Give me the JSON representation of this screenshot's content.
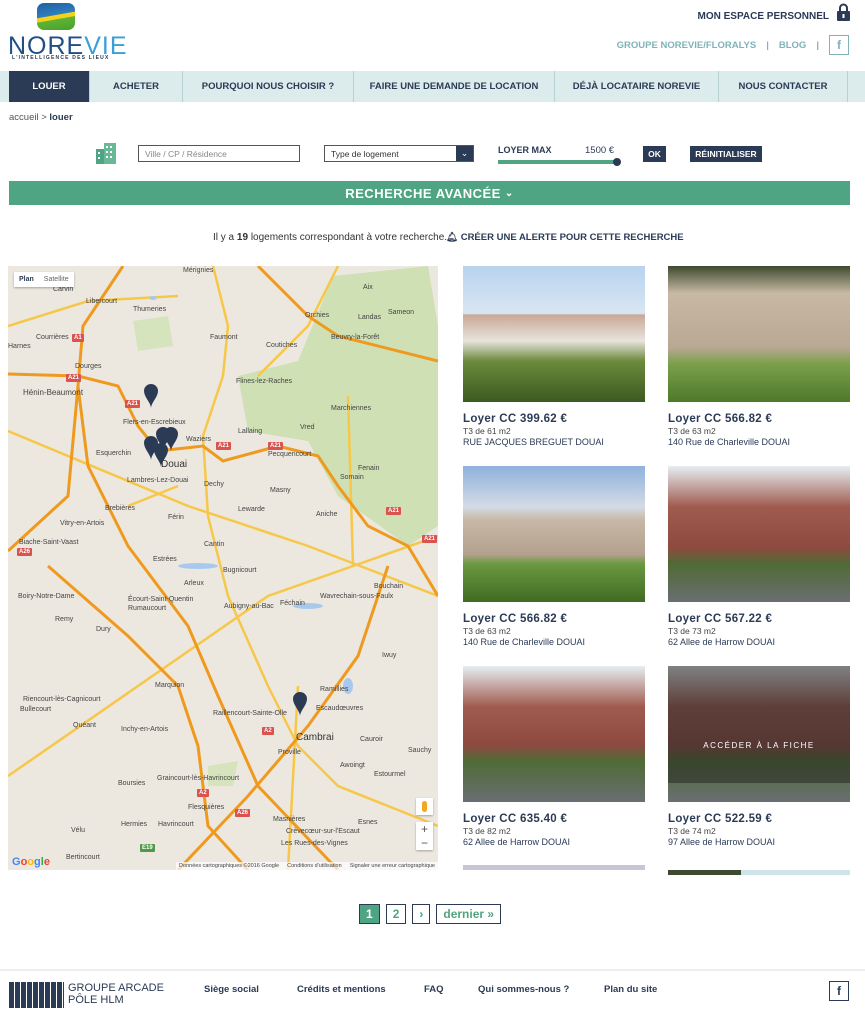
{
  "header": {
    "logo_text": "NOREVIE",
    "logo_tagline": "L'INTELLIGENCE DES LIEUX",
    "espace": "MON ESPACE PERSONNEL",
    "links": [
      "GROUPE NOREVIE/FLORALYS",
      "BLOG"
    ],
    "facebook": "f"
  },
  "nav": [
    "LOUER",
    "ACHETER",
    "POURQUOI NOUS CHOISIR ?",
    "FAIRE UNE DEMANDE DE LOCATION",
    "DÉJÀ LOCATAIRE NOREVIE",
    "NOUS CONTACTER"
  ],
  "breadcrumb": {
    "home": "accueil",
    "sep": ">",
    "current": "louer"
  },
  "search": {
    "placeholder": "Ville / CP / Résidence",
    "type_select": "Type de logement",
    "loyer_label": "LOYER MAX",
    "loyer_value": "1500 €",
    "loyer_fraction": 1.0,
    "ok": "OK",
    "reset": "RÉINITIALISER",
    "advanced": "RECHERCHE AVANCÉE"
  },
  "results": {
    "prefix": "Il y a",
    "count": "19",
    "suffix": "logements correspondant à votre recherche.",
    "alert": "CRÉER UNE ALERTE POUR CETTE RECHERCHE"
  },
  "map": {
    "plan": "Plan",
    "satellite": "Satellite",
    "google": "Google",
    "attribution": [
      "Données cartographiques ©2016 Google",
      "Conditions d'utilisation",
      "Signaler une erreur cartographique"
    ],
    "towns": [
      "Mérignies",
      "Carvin",
      "Libercourt",
      "Thumeries",
      "Courrières",
      "Harnes",
      "Dourges",
      "Hénin-Beaumont",
      "Flers-en-Escrebieux",
      "Waziers",
      "Esquerchin",
      "Douai",
      "Lambres-Lez-Douai",
      "Dechy",
      "Faumont",
      "Coutiches",
      "Flines-lez-Raches",
      "Orchies",
      "Landas",
      "Sameon",
      "Aix",
      "Beuvry-la-Forêt",
      "Marchiennes",
      "Vred",
      "Lallaing",
      "Pecquencourt",
      "Fenain",
      "Somain",
      "Masny",
      "Lewarde",
      "Aniche",
      "Férin",
      "Brebières",
      "Vitry-en-Artois",
      "Biache-Saint-Vaast",
      "Cantin",
      "Estrées",
      "Bugnicourt",
      "Arleux",
      "Aubigny-au-Bac",
      "Féchain",
      "Wavrechain-sous-Faulx",
      "Bouchain",
      "Boiry-Notre-Dame",
      "Remy",
      "Dury",
      "Écourt-Saint-Quentin",
      "Rumaucourt",
      "Iwuy",
      "Marquion",
      "Riencourt-lès-Cagnicourt",
      "Bullecourt",
      "Quéant",
      "Inchy-en-Artois",
      "Raillencourt-Sainte-Olle",
      "Ramillies",
      "Escaudœuvres",
      "Cambrai",
      "Cauroir",
      "Proville",
      "Awoingt",
      "Estourmel",
      "Boursies",
      "Graincourt-lès-Havrincourt",
      "Flesquières",
      "Hermies",
      "Havrincourt",
      "Vélu",
      "Bertincourt",
      "Masnières",
      "Crèvecœur-sur-l'Escaut",
      "Les Rues-des-Vignes",
      "Esnes",
      "Sauchy"
    ],
    "roads": [
      "A1",
      "A21",
      "A2",
      "A26",
      "E19"
    ],
    "zoom_in": "+",
    "zoom_out": "−"
  },
  "listings": [
    {
      "price": "Loyer CC 399.62 €",
      "type": "T3 de 61 m2",
      "address": "RUE JACQUES BREGUET DOUAI"
    },
    {
      "price": "Loyer CC 566.82 €",
      "type": "T3 de 63 m2",
      "address": "140 Rue de Charleville DOUAI"
    },
    {
      "price": "Loyer CC 566.82 €",
      "type": "T3 de 63 m2",
      "address": "140 Rue de Charleville DOUAI"
    },
    {
      "price": "Loyer CC 567.22 €",
      "type": "T3 de 73 m2",
      "address": "62 Allee de Harrow DOUAI"
    },
    {
      "price": "Loyer CC 635.40 €",
      "type": "T3 de 82 m2",
      "address": "62 Allee de Harrow DOUAI"
    },
    {
      "price": "Loyer CC 522.59 €",
      "type": "T3 de 74 m2",
      "address": "97 Allee de Harrow DOUAI",
      "overlay": "ACCÉDER À LA FICHE"
    }
  ],
  "pagination": {
    "pages": [
      "1",
      "2"
    ],
    "next": "›",
    "last": "dernier »",
    "current": "1"
  },
  "footer": {
    "arcade_logo": "groupe Arcade",
    "arcade_line1": "GROUPE ARCADE",
    "arcade_line2": "PÔLE HLM",
    "links": [
      "Siège social",
      "Crédits et mentions",
      "FAQ",
      "Qui sommes-nous ?",
      "Plan du site"
    ],
    "facebook": "f"
  },
  "colors": {
    "navy": "#2b3a55",
    "green": "#4fa583",
    "nav_bg": "#dcebeb",
    "teal": "#7fb3b8"
  }
}
